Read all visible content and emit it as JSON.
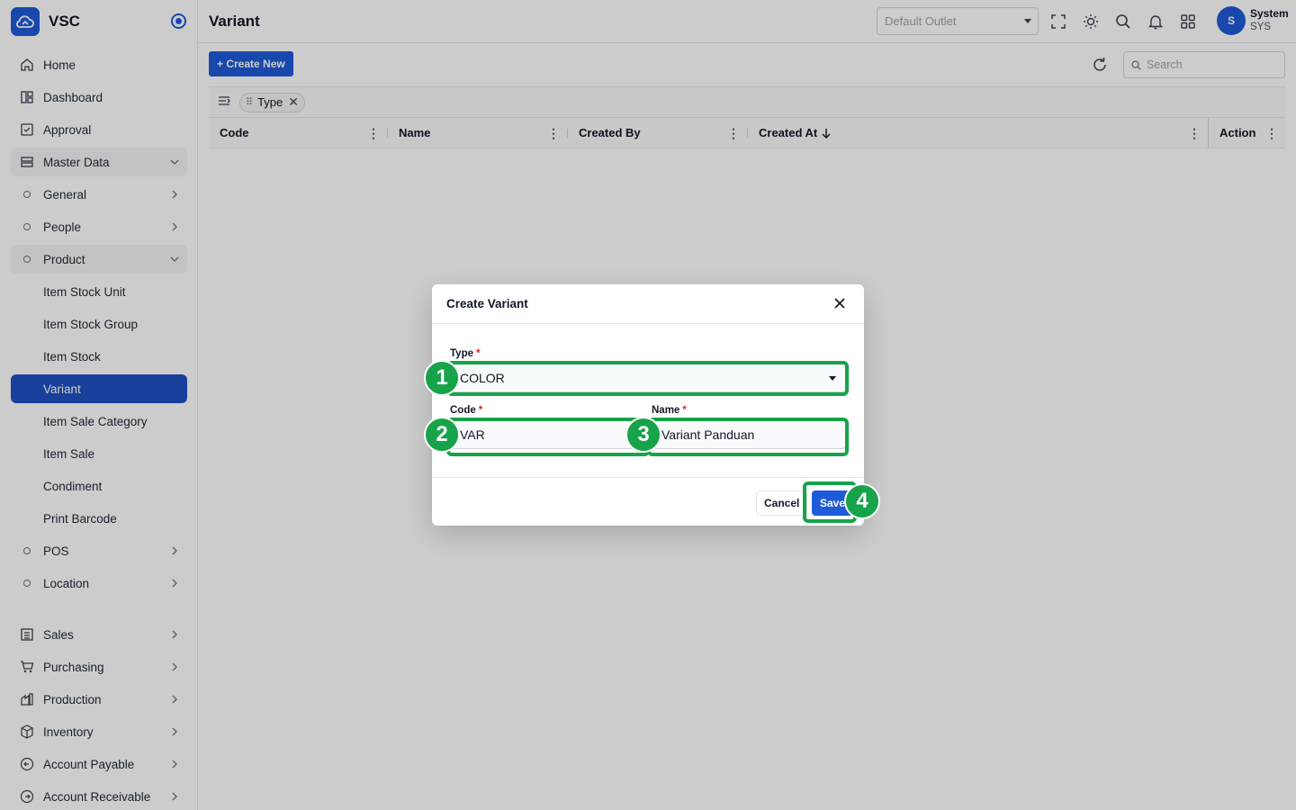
{
  "app": {
    "name": "VSC"
  },
  "sidebar": {
    "items": [
      {
        "label": "Home"
      },
      {
        "label": "Dashboard"
      },
      {
        "label": "Approval"
      },
      {
        "label": "Master Data"
      },
      {
        "label": "General"
      },
      {
        "label": "People"
      },
      {
        "label": "Product"
      },
      {
        "label": "Item Stock Unit"
      },
      {
        "label": "Item Stock Group"
      },
      {
        "label": "Item Stock"
      },
      {
        "label": "Variant"
      },
      {
        "label": "Item Sale Category"
      },
      {
        "label": "Item Sale"
      },
      {
        "label": "Condiment"
      },
      {
        "label": "Print Barcode"
      },
      {
        "label": "POS"
      },
      {
        "label": "Location"
      },
      {
        "label": "Sales"
      },
      {
        "label": "Purchasing"
      },
      {
        "label": "Production"
      },
      {
        "label": "Inventory"
      },
      {
        "label": "Account Payable"
      },
      {
        "label": "Account Receivable"
      }
    ]
  },
  "header": {
    "title": "Variant",
    "outlet_placeholder": "Default Outlet",
    "user": {
      "initial": "S",
      "name": "System",
      "code": "SYS"
    }
  },
  "toolbar": {
    "create_label": "+ Create New",
    "search_placeholder": "Search"
  },
  "group_chip": {
    "label": "Type"
  },
  "table": {
    "columns": [
      "Code",
      "Name",
      "Created By",
      "Created At",
      "Action"
    ]
  },
  "modal": {
    "title": "Create Variant",
    "type_label": "Type",
    "type_value": "COLOR",
    "code_label": "Code",
    "code_value": "VAR",
    "name_label": "Name",
    "name_value": "Variant Panduan",
    "required_mark": "*",
    "cancel_label": "Cancel",
    "save_label": "Save"
  },
  "annotations": [
    "1",
    "2",
    "3",
    "4"
  ],
  "colors": {
    "primary": "#1e5bd8",
    "active_nav": "#1e4fc2",
    "highlight": "#16a34a",
    "required": "#dc2626"
  }
}
